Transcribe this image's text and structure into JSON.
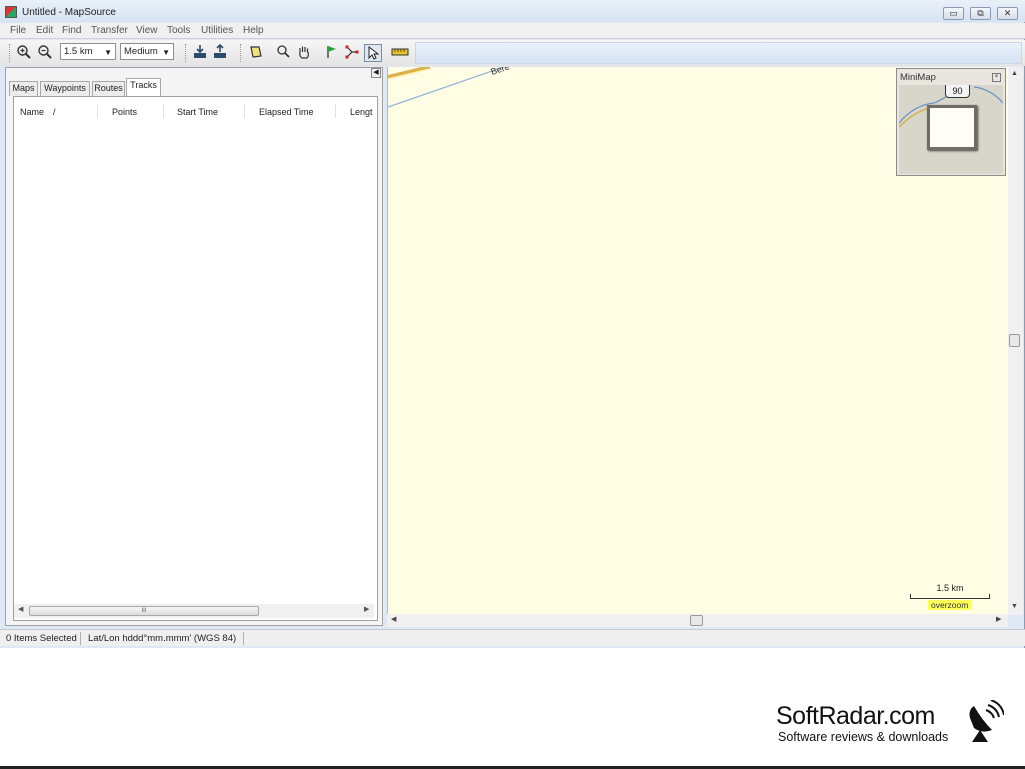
{
  "window": {
    "title": "Untitled - MapSource",
    "minimize": "▭",
    "restore": "⧉",
    "close": "✕"
  },
  "menu": [
    "File",
    "Edit",
    "Find",
    "Transfer",
    "View",
    "Tools",
    "Utilities",
    "Help"
  ],
  "toolbar": {
    "zoom_in_icon": "zoom-in-icon",
    "zoom_out_icon": "zoom-out-icon",
    "zoom_scale": "1.5 km",
    "detail_level": "Medium"
  },
  "tabs": [
    "Maps",
    "Waypoints",
    "Routes",
    "Tracks"
  ],
  "selected_tab": "Tracks",
  "columns": [
    "Name",
    "/",
    "Points",
    "Start Time",
    "Elapsed Time",
    "Lengt"
  ],
  "tracks": [],
  "hscroll_grip": "III",
  "map": {
    "road_label": "Bere",
    "minimap_title": "MiniMap",
    "minimap_shield": "90",
    "scale_label": "1.5 km",
    "overzoom_label": "overzoom"
  },
  "status": {
    "selection": "0 Items Selected",
    "position_format": "Lat/Lon hddd°mm.mmm' (WGS 84)"
  },
  "watermark": {
    "title": "SoftRadar.com",
    "subtitle": "Software reviews & downloads"
  }
}
